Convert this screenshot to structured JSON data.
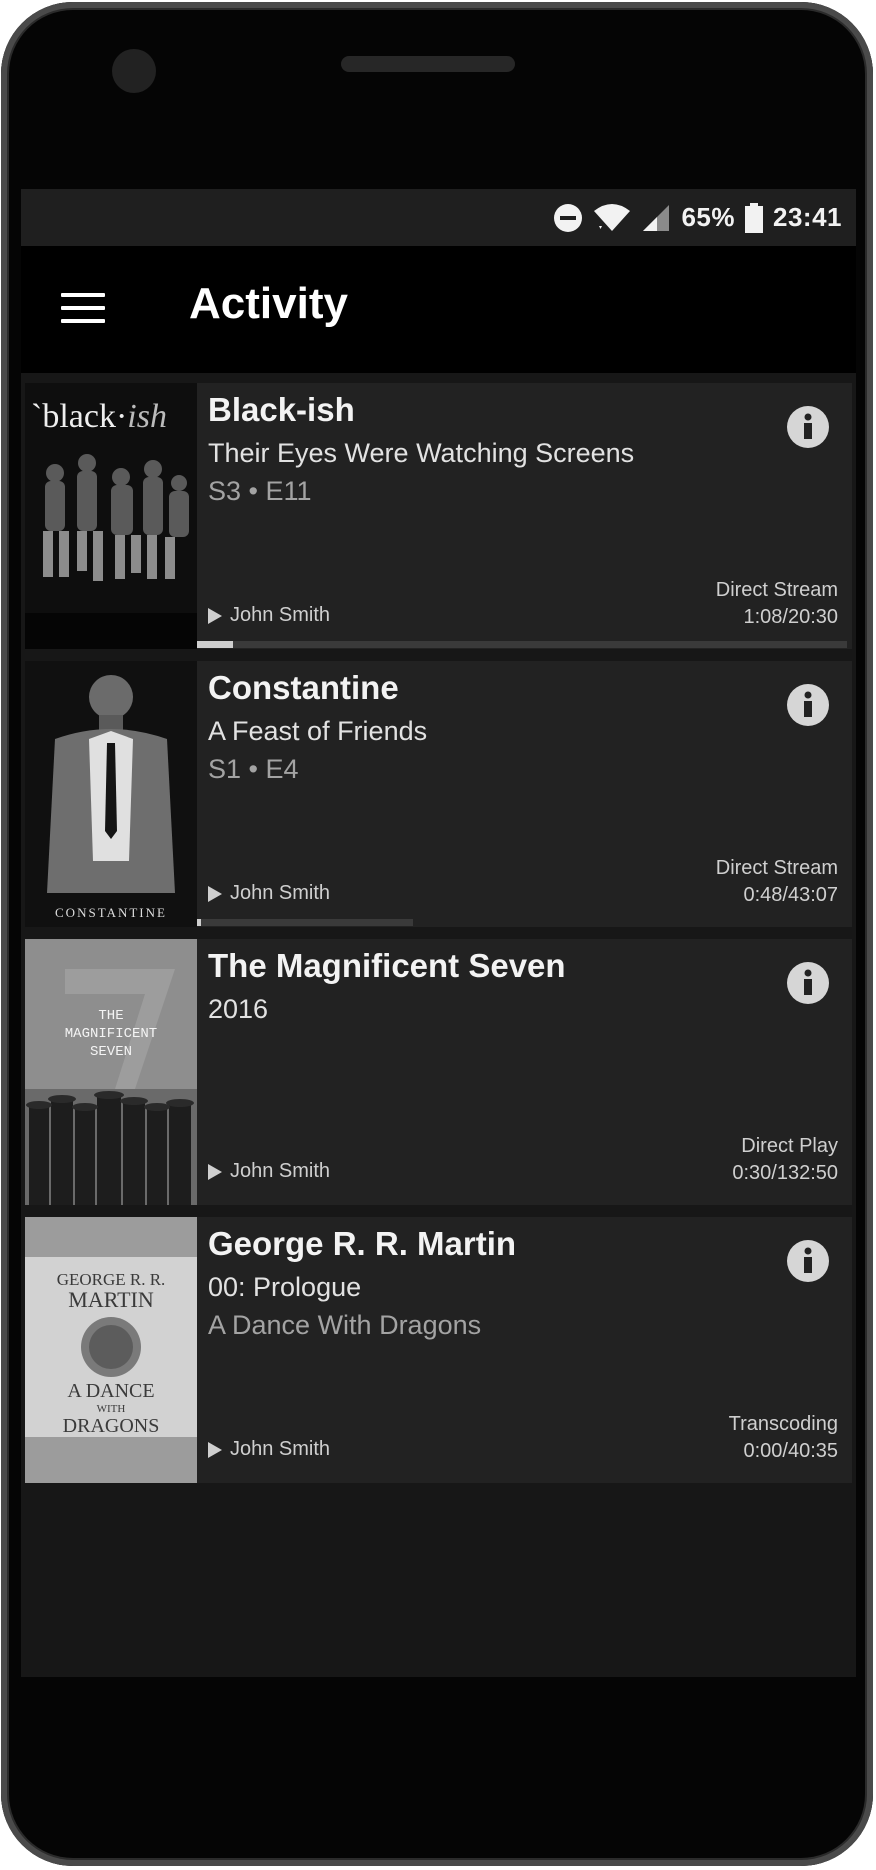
{
  "status_bar": {
    "battery": "65%",
    "time": "23:41"
  },
  "app_bar": {
    "title": "Activity"
  },
  "sessions": [
    {
      "title": "Black-ish",
      "subtitle": "Their Eyes Were Watching Screens",
      "detail": "S3 • E11",
      "poster_text": "`black·ish",
      "user": "John Smith",
      "method": "Direct Stream",
      "position": "1:08/20:30",
      "progress": 0.055
    },
    {
      "title": "Constantine",
      "subtitle": "A Feast of Friends",
      "detail": "S1 • E4",
      "poster_text": "CONSTANTINE",
      "user": "John Smith",
      "method": "Direct Stream",
      "position": "0:48/43:07",
      "progress": 0.011
    },
    {
      "title": "The Magnificent Seven",
      "subtitle": "2016",
      "detail": "",
      "poster_text": "THE MAGNIFICENT SEVEN",
      "user": "John Smith",
      "method": "Direct Play",
      "position": "0:30/132:50",
      "progress": 0.004
    },
    {
      "title": "George R. R. Martin",
      "subtitle": "00: Prologue",
      "detail": "A Dance With Dragons",
      "poster_text": "GEORGE R. R. MARTIN A DANCE WITH DRAGONS",
      "user": "John Smith",
      "method": "Transcoding",
      "position": "0:00/40:35",
      "progress": 0.0
    }
  ]
}
